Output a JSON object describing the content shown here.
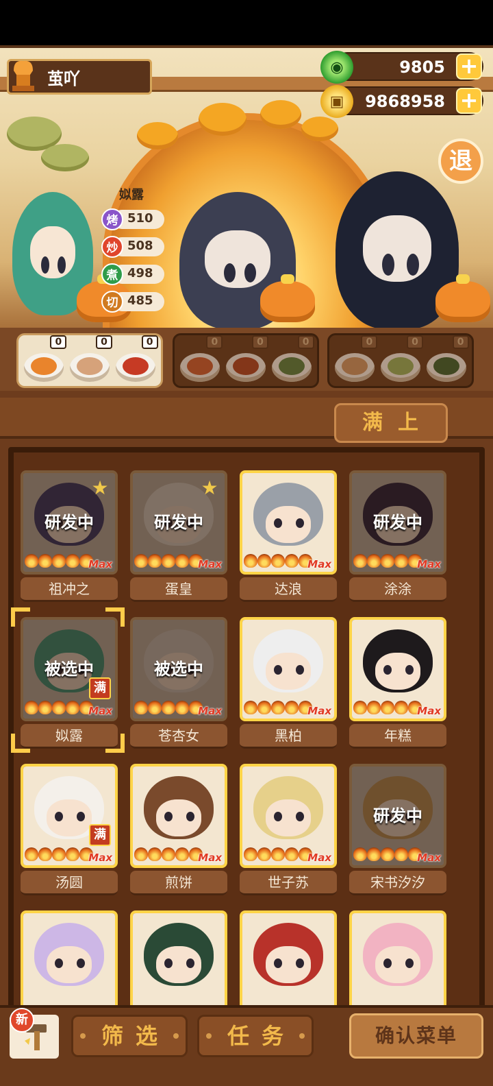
{
  "player": {
    "name": "茧吖"
  },
  "currency": {
    "jade": "9805",
    "coins": "9868958"
  },
  "exit": {
    "label": "退"
  },
  "stats": {
    "character": "姒露",
    "items": [
      {
        "skill": "烤",
        "value": "510",
        "color": "#8a55c9"
      },
      {
        "skill": "炒",
        "value": "508",
        "color": "#e0452c"
      },
      {
        "skill": "煮",
        "value": "498",
        "color": "#2f9c4a"
      },
      {
        "skill": "切",
        "value": "485",
        "color": "#d07a1f"
      }
    ]
  },
  "dish_groups": [
    {
      "state": "active",
      "dishes": [
        {
          "count": "0",
          "color": "#e9842c"
        },
        {
          "count": "0",
          "color": "#d6a27a"
        },
        {
          "count": "0",
          "color": "#c63a24"
        }
      ]
    },
    {
      "state": "inactive",
      "dishes": [
        {
          "count": "0",
          "color": "#c6532a"
        },
        {
          "count": "0",
          "color": "#a63a1c"
        },
        {
          "count": "0",
          "color": "#4c7a3a"
        }
      ]
    },
    {
      "state": "inactive",
      "dishes": [
        {
          "count": "0",
          "color": "#c99260"
        },
        {
          "count": "0",
          "color": "#8fae5a"
        },
        {
          "count": "0",
          "color": "#2d5a2a"
        }
      ]
    }
  ],
  "full_button": {
    "label": "满上"
  },
  "chefs": [
    {
      "name": "祖冲之",
      "status": "研发中",
      "gold": false,
      "star": true,
      "hair": "#3d3a6a",
      "max": "Max"
    },
    {
      "name": "蛋皇",
      "status": "研发中",
      "gold": false,
      "star": true,
      "hair": "#e9e0d2",
      "max": "Max"
    },
    {
      "name": "达浪",
      "status": "",
      "gold": true,
      "star": false,
      "hair": "#9aa0a8",
      "max": "Max"
    },
    {
      "name": "涂涂",
      "status": "研发中",
      "gold": false,
      "star": false,
      "hair": "#2e2540",
      "max": "Max"
    },
    {
      "name": "姒露",
      "status": "被选中",
      "gold": false,
      "star": false,
      "hair": "#3f9b7f",
      "max": "Max",
      "full": "满",
      "selected": true
    },
    {
      "name": "苍杏女",
      "status": "被选中",
      "gold": false,
      "star": false,
      "hair": "#d8cfc3",
      "max": "Max"
    },
    {
      "name": "黑柏",
      "status": "",
      "gold": true,
      "star": false,
      "hair": "#eeeeee",
      "max": "Max"
    },
    {
      "name": "年糕",
      "status": "",
      "gold": true,
      "star": false,
      "hair": "#1e1a1c",
      "max": "Max"
    },
    {
      "name": "汤圆",
      "status": "",
      "gold": true,
      "star": false,
      "hair": "#f4f0ea",
      "max": "Max",
      "full": "满"
    },
    {
      "name": "煎饼",
      "status": "",
      "gold": true,
      "star": false,
      "hair": "#7a4a2c",
      "max": "Max"
    },
    {
      "name": "世子苏",
      "status": "",
      "gold": true,
      "star": false,
      "hair": "#e6d08a",
      "max": "Max"
    },
    {
      "name": "宋书汐汐",
      "status": "研发中",
      "gold": false,
      "star": false,
      "hair": "#c59a5a",
      "max": "Max"
    },
    {
      "name": "",
      "status": "",
      "gold": true,
      "star": false,
      "hair": "#cdb7e6",
      "max": ""
    },
    {
      "name": "",
      "status": "",
      "gold": true,
      "star": false,
      "hair": "#2a4a36",
      "max": ""
    },
    {
      "name": "",
      "status": "",
      "gold": true,
      "star": false,
      "hair": "#b8322a",
      "max": ""
    },
    {
      "name": "",
      "status": "",
      "gold": true,
      "star": false,
      "hair": "#f2b3c2",
      "max": ""
    }
  ],
  "bottom": {
    "new_badge": "新",
    "filter": "筛选",
    "task": "任务",
    "confirm": "确认菜单"
  }
}
